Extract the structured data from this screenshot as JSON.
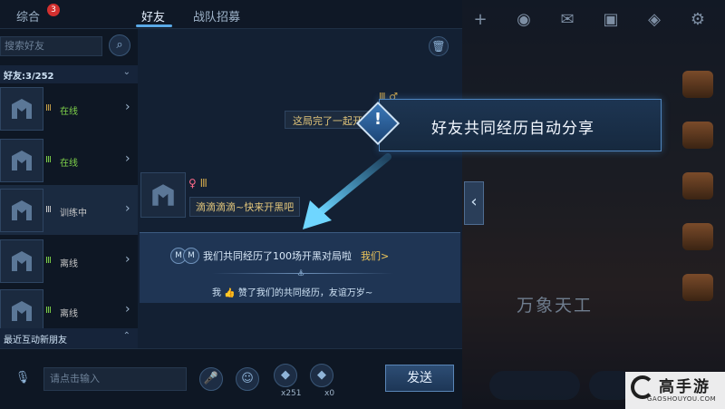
{
  "tabs": [
    {
      "label": "综合",
      "badge": "3"
    },
    {
      "label": "好友"
    },
    {
      "label": "战队招募"
    }
  ],
  "sidebar": {
    "search_placeholder": "搜索好友",
    "friend_count": "好友:3/252",
    "friends": [
      {
        "status": "在线",
        "status_color": "#7fd34a"
      },
      {
        "status": "在线",
        "status_color": "#7fd34a"
      },
      {
        "status": "训练中",
        "status_color": "#c9c9c9"
      },
      {
        "status": "离线",
        "status_color": "#c9c9c9"
      },
      {
        "status": "离线",
        "status_color": "#c9c9c9"
      }
    ],
    "recent_label": "最近互动新朋友"
  },
  "chat": {
    "msg_right": "这局完了一起开",
    "msg_left": "滴滴滴滴~快来开黑吧"
  },
  "share_card": {
    "title": "我们共同经历了100场开黑对局啦",
    "link": "我们>",
    "sub_prefix": "我",
    "sub_suffix": "赞了我们的共同经历，友谊万岁~"
  },
  "popup": {
    "glyph": "!",
    "text": "好友共同经历自动分享"
  },
  "input_bar": {
    "placeholder": "请点击输入",
    "count_1": "x251",
    "count_2": "x0",
    "send": "发送"
  },
  "background": {
    "banner": "万象天工"
  },
  "watermark": {
    "title": "高手游",
    "url": "GAOSHOUYOU.COM"
  },
  "colors": {
    "accent": "#5aa9e6",
    "online": "#7fd34a",
    "highlight_text": "#e0c47a",
    "link": "#f0c75a"
  }
}
